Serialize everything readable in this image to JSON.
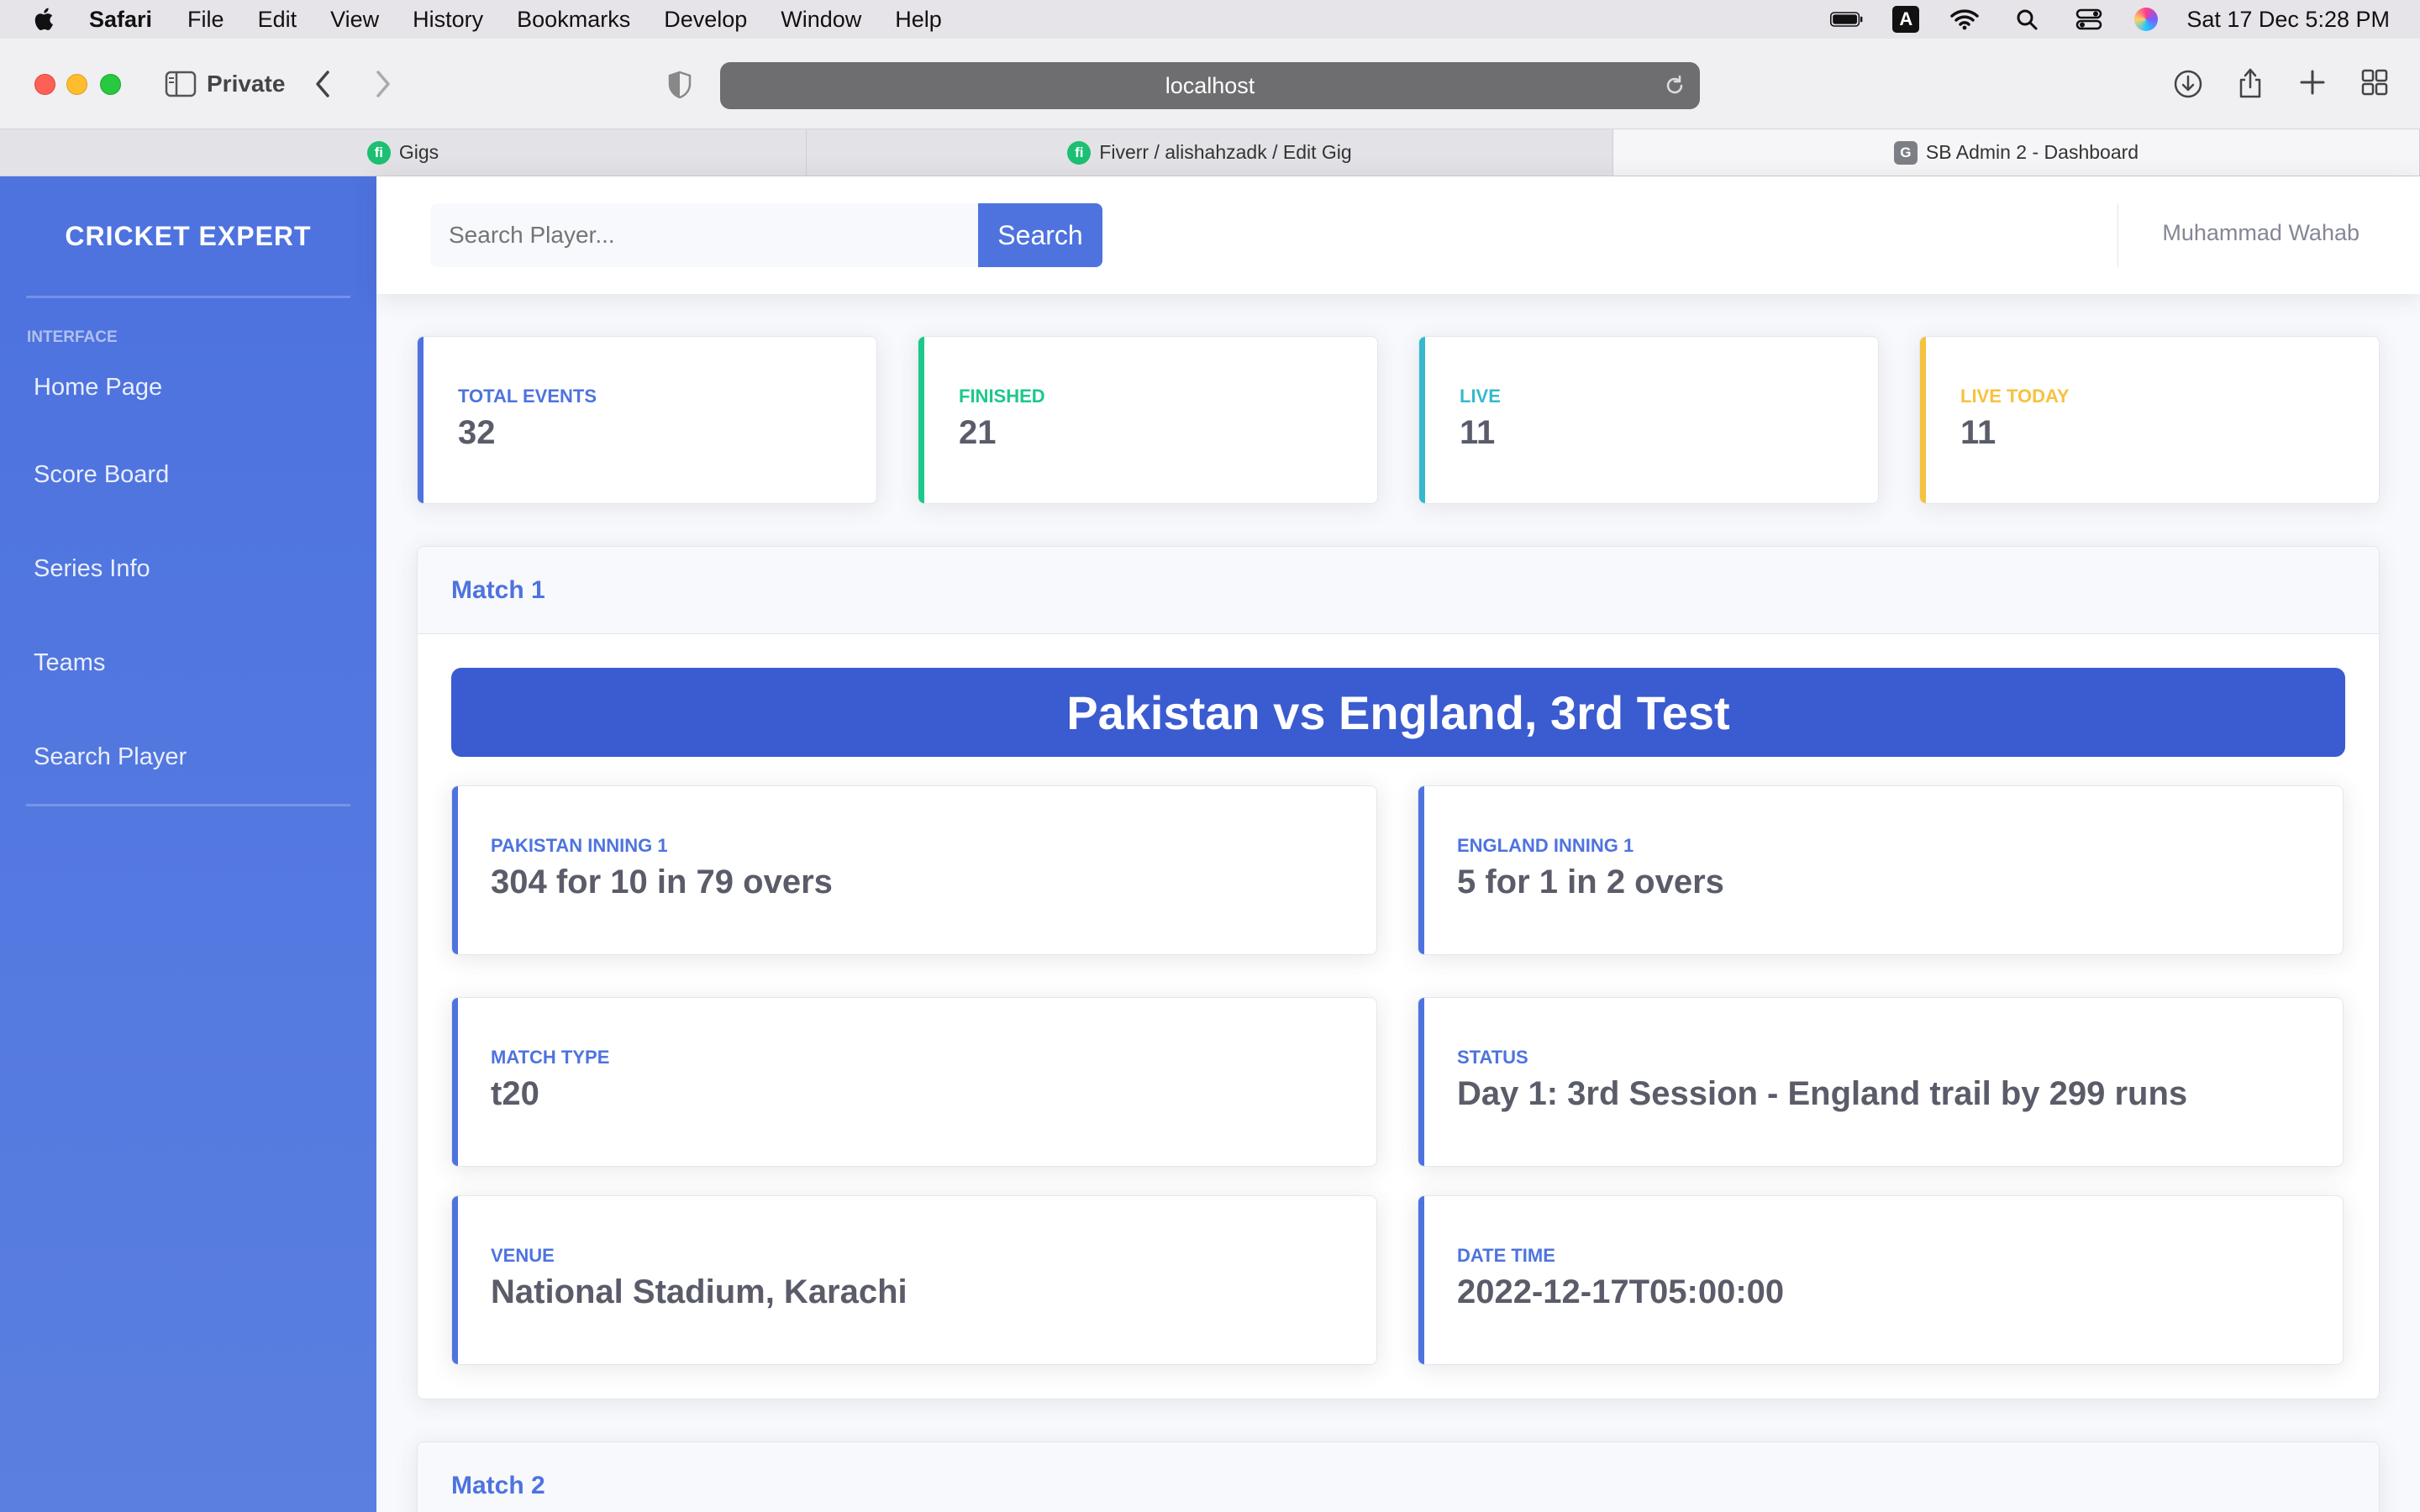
{
  "menubar": {
    "app": "Safari",
    "items": [
      "File",
      "Edit",
      "View",
      "History",
      "Bookmarks",
      "Develop",
      "Window",
      "Help"
    ],
    "input_source": "A",
    "datetime": "Sat 17 Dec  5:28 PM"
  },
  "browser": {
    "private_label": "Private",
    "url": "localhost",
    "tabs": [
      {
        "label": "Gigs",
        "icon": "fiverr-favicon"
      },
      {
        "label": "Fiverr / alishahzadk / Edit Gig",
        "icon": "fiverr-favicon"
      },
      {
        "label": "SB Admin 2 - Dashboard",
        "icon": "g-favicon"
      }
    ],
    "favicon_letters": {
      "fiverr": "fi",
      "g": "G"
    }
  },
  "sidebar": {
    "brand": "CRICKET EXPERT",
    "heading": "INTERFACE",
    "items": [
      {
        "label": "Home Page"
      },
      {
        "label": "Score Board"
      },
      {
        "label": "Series Info"
      },
      {
        "label": "Teams"
      },
      {
        "label": "Search Player"
      }
    ]
  },
  "topbar": {
    "search_placeholder": "Search Player...",
    "search_button": "Search",
    "user": "Muhammad Wahab"
  },
  "stats": [
    {
      "label": "TOTAL EVENTS",
      "value": "32",
      "color": "#4e73df"
    },
    {
      "label": "FINISHED",
      "value": "21",
      "color": "#1cc88a"
    },
    {
      "label": "LIVE",
      "value": "11",
      "color": "#36b9cc"
    },
    {
      "label": "LIVE TODAY",
      "value": "11",
      "color": "#f6c23e"
    }
  ],
  "matches": [
    {
      "header": "Match 1",
      "title": "Pakistan vs England, 3rd Test",
      "fields": [
        {
          "label": "PAKISTAN INNING 1",
          "value": "304 for 10 in 79 overs"
        },
        {
          "label": "ENGLAND INNING 1",
          "value": "5 for 1 in 2 overs"
        },
        {
          "label": "MATCH TYPE",
          "value": "t20"
        },
        {
          "label": "STATUS",
          "value": "Day 1: 3rd Session - England trail by 299 runs"
        },
        {
          "label": "VENUE",
          "value": "National Stadium, Karachi"
        },
        {
          "label": "DATE TIME",
          "value": "2022-12-17T05:00:00"
        }
      ]
    },
    {
      "header": "Match 2"
    }
  ],
  "colors": {
    "primary": "#4e73df",
    "title_bar": "#3b5bd0",
    "success": "#1cc88a",
    "info": "#36b9cc",
    "warning": "#f6c23e"
  }
}
